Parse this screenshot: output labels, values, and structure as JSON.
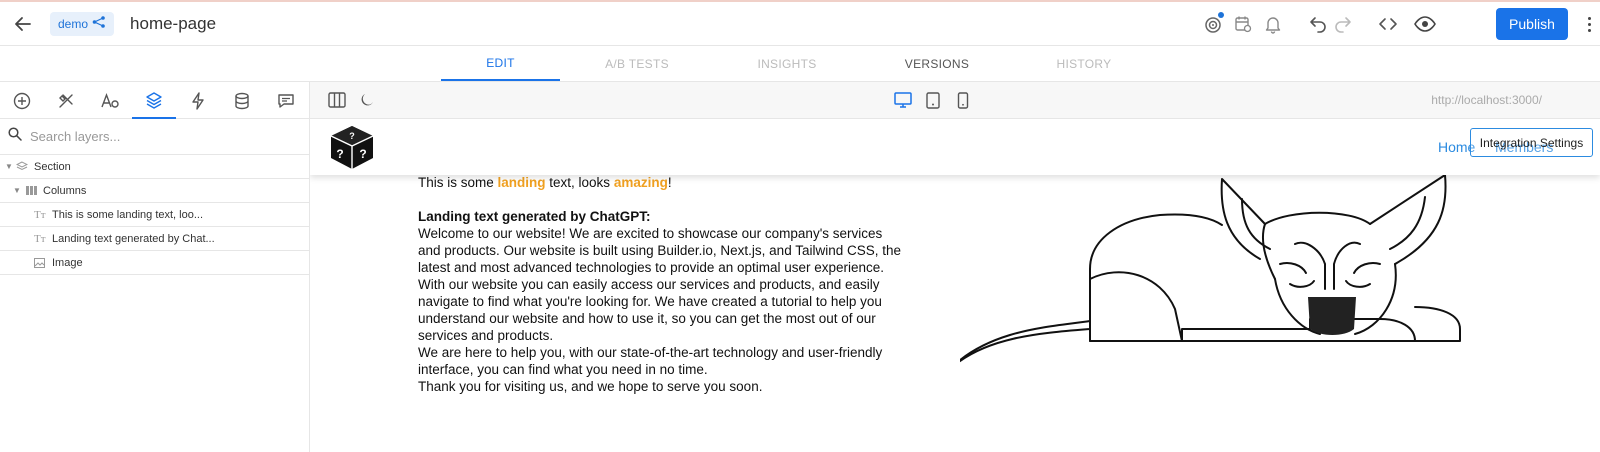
{
  "header": {
    "badge_label": "demo",
    "page_title": "home-page",
    "publish_label": "Publish"
  },
  "tabs": [
    {
      "label": "EDIT"
    },
    {
      "label": "A/B TESTS"
    },
    {
      "label": "INSIGHTS"
    },
    {
      "label": "VERSIONS"
    },
    {
      "label": "HISTORY"
    }
  ],
  "left_panel": {
    "search_placeholder": "Search layers...",
    "layers": [
      {
        "label": "Section",
        "icon": "layers-icon"
      },
      {
        "label": "Columns",
        "icon": "columns-icon"
      },
      {
        "label": "This is some landing text, loo...",
        "icon": "text-icon"
      },
      {
        "label": "Landing text generated by Chat...",
        "icon": "text-icon"
      },
      {
        "label": "Image",
        "icon": "image-icon"
      }
    ]
  },
  "canvas": {
    "url": "http://localhost:3000/"
  },
  "preview": {
    "nav": {
      "home": "Home",
      "members": "Members",
      "integration": "Integration Settings"
    },
    "landing": {
      "before": "This is some ",
      "word1": "landing",
      "middle": " text, looks ",
      "word2": "amazing",
      "after": "!"
    },
    "heading": "Landing text generated by ChatGPT:",
    "paragraph": "Welcome to our website! We are excited to showcase our company's services\nand products. Our website is built using Builder.io, Next.js, and Tailwind CSS, the\nlatest and most advanced technologies to provide an optimal user experience.\nWith our website you can easily access our services and products, and easily\nnavigate to find what you're looking for. We have created a tutorial to help you\nunderstand our website and how to use it, so you can get the most out of our\nservices and products.\nWe are here to help you, with our state-of-the-art technology and user-friendly\ninterface, you can find what you need in no time.\nThank you for visiting us, and we hope to serve you soon."
  },
  "colors": {
    "accent": "#1a73e8",
    "highlight": "#f0a020",
    "link": "#2c8be0"
  }
}
